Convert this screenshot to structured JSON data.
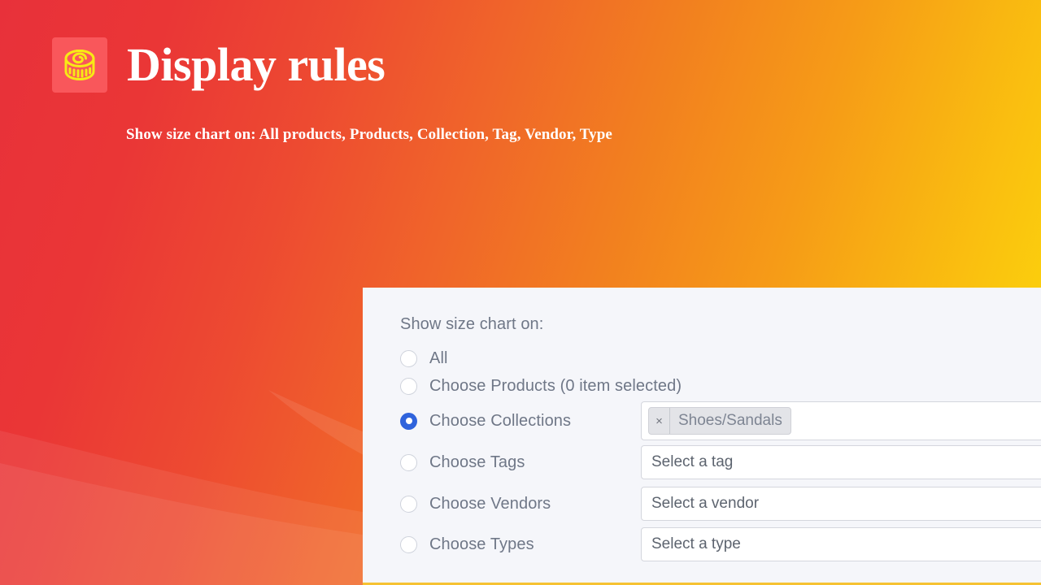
{
  "header": {
    "title": "Display rules",
    "subtitle": "Show size chart on: All products, Products, Collection, Tag, Vendor, Type",
    "icon": "measuring-tape-icon",
    "icon_tile_color": "#f9575b",
    "title_color": "#ffffff"
  },
  "background": {
    "gradient_start": "#e8313a",
    "gradient_mid": "#f2801f",
    "gradient_end": "#fcd90c"
  },
  "panel": {
    "heading": "Show size chart on:",
    "background_color": "#f5f6fa",
    "accent_selected_color": "#2f63dc",
    "options": [
      {
        "id": "all",
        "label": "All",
        "selected": false,
        "control": "none"
      },
      {
        "id": "products",
        "label": "Choose Products (0 item selected)",
        "selected": false,
        "control": "none"
      },
      {
        "id": "collections",
        "label": "Choose Collections",
        "selected": true,
        "control": "multiselect",
        "chips": [
          {
            "remove_label": "×",
            "label": "Shoes/Sandals"
          }
        ]
      },
      {
        "id": "tags",
        "label": "Choose Tags",
        "selected": false,
        "control": "select",
        "placeholder": "Select a tag"
      },
      {
        "id": "vendors",
        "label": "Choose Vendors",
        "selected": false,
        "control": "select",
        "placeholder": "Select a vendor"
      },
      {
        "id": "types",
        "label": "Choose Types",
        "selected": false,
        "control": "select",
        "placeholder": "Select a type"
      }
    ]
  }
}
